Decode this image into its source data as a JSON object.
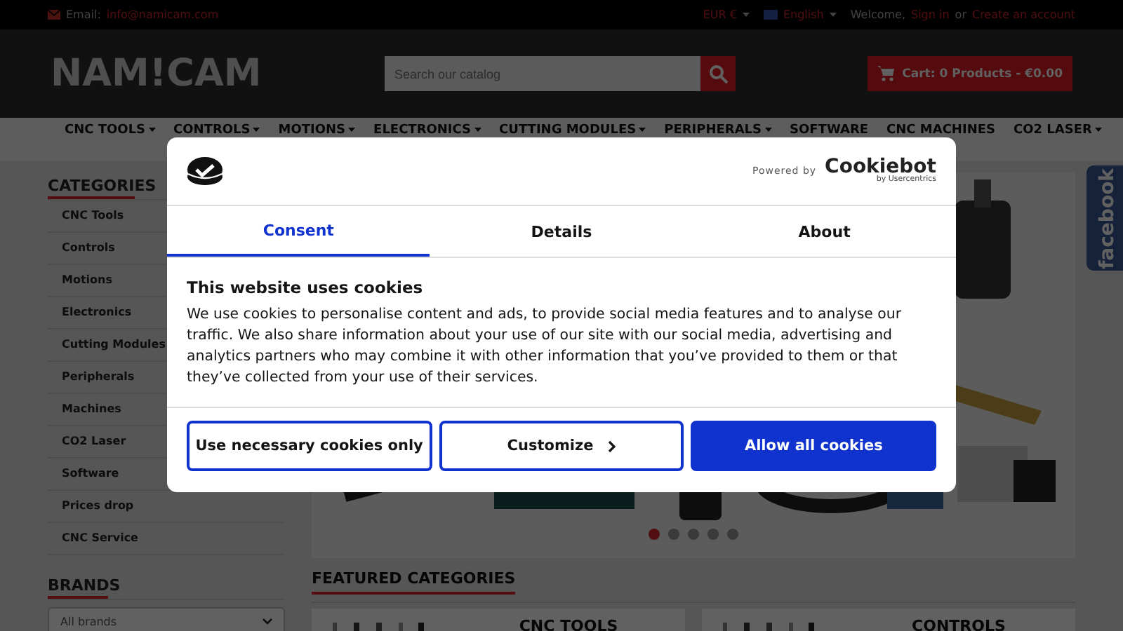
{
  "top_bar": {
    "email_label": "Email:",
    "email": "info@namicam.com",
    "currency": "EUR €",
    "language": "English",
    "welcome": "Welcome,",
    "sign_in": "Sign in",
    "or": "or",
    "create_account": "Create an account"
  },
  "header": {
    "logo": "NAM!CAM",
    "search": {
      "placeholder": "Search our catalog"
    },
    "cart": "Cart: 0 Products - €0.00"
  },
  "nav": [
    {
      "label": "CNC TOOLS",
      "has_menu": true
    },
    {
      "label": "CONTROLS",
      "has_menu": true
    },
    {
      "label": "MOTIONS",
      "has_menu": true
    },
    {
      "label": "ELECTRONICS",
      "has_menu": true
    },
    {
      "label": "CUTTING MODULES",
      "has_menu": true
    },
    {
      "label": "PERIPHERALS",
      "has_menu": true
    },
    {
      "label": "SOFTWARE",
      "has_menu": false
    },
    {
      "label": "CNC MACHINES",
      "has_menu": false
    },
    {
      "label": "CO2 LASER",
      "has_menu": true
    }
  ],
  "sidebar": {
    "categories_title": "CATEGORIES",
    "categories": [
      "CNC Tools",
      "Controls",
      "Motions",
      "Electronics",
      "Cutting Modules",
      "Peripherals",
      "Machines",
      "CO2 Laser",
      "Software",
      "Prices drop",
      "CNC Service"
    ],
    "brands_title": "BRANDS",
    "brands_select": "All brands"
  },
  "slider": {
    "dots": [
      {
        "selected": true
      },
      {
        "selected": false
      },
      {
        "selected": false
      },
      {
        "selected": false
      },
      {
        "selected": false
      }
    ]
  },
  "featured": {
    "title": "FEATURED CATEGORIES",
    "cards": [
      "CNC TOOLS",
      "CONTROLS"
    ]
  },
  "side_tab": "facebook",
  "cookie_dialog": {
    "powered_by": "Powered by",
    "brand": "Cookiebot",
    "brand_sub": "by Usercentrics",
    "tabs": [
      {
        "label": "Consent",
        "selected": true
      },
      {
        "label": "Details",
        "selected": false
      },
      {
        "label": "About",
        "selected": false
      }
    ],
    "heading": "This website uses cookies",
    "text": "We use cookies to personalise content and ads, to provide social media features and to analyse our traffic. We also share information about your use of our site with our social media, advertising and analytics partners who may combine it with other information that you’ve provided to them or that they’ve collected from your use of their services.",
    "buttons": [
      {
        "label": "Use necessary cookies only",
        "kind": "outline"
      },
      {
        "label": "Customize",
        "kind": "chevron"
      },
      {
        "label": "Allow all cookies",
        "kind": "primary"
      }
    ]
  }
}
